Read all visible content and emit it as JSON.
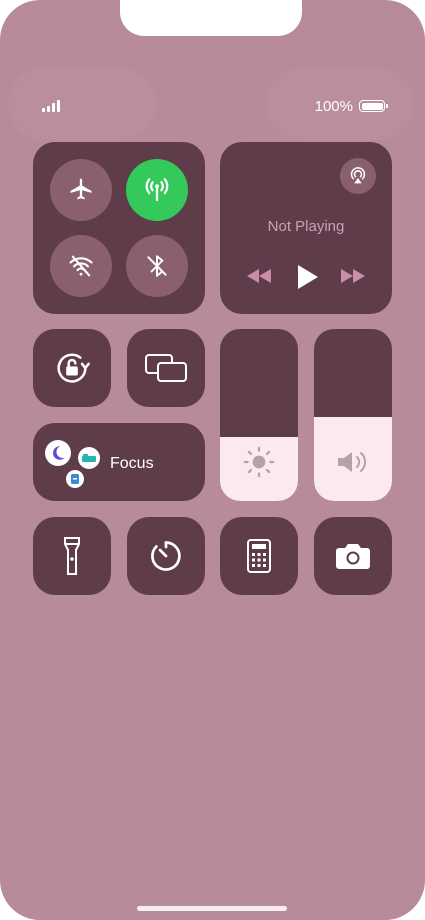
{
  "status_bar": {
    "battery_percent": "100%",
    "signal_bars": 4
  },
  "connectivity": {
    "airplane": {
      "icon": "airplane-icon",
      "active": false
    },
    "cellular": {
      "icon": "cellular-antenna-icon",
      "active": true,
      "active_color": "#33c95b"
    },
    "wifi": {
      "icon": "wifi-off-icon",
      "active": false
    },
    "bluetooth": {
      "icon": "bluetooth-off-icon",
      "active": false
    }
  },
  "media": {
    "now_playing": "Not Playing",
    "airplay_icon": "airplay-audio-icon",
    "controls": [
      "rewind-icon",
      "play-icon",
      "fast-forward-icon"
    ]
  },
  "toggles": {
    "orientation_lock_icon": "orientation-lock-icon",
    "screen_mirroring_icon": "screen-mirroring-icon"
  },
  "focus": {
    "label": "Focus",
    "icons": [
      "moon-icon",
      "bed-icon",
      "id-badge-icon"
    ]
  },
  "sliders": {
    "brightness": {
      "level_percent": 37,
      "icon": "sun-icon"
    },
    "volume": {
      "level_percent": 49,
      "icon": "speaker-icon"
    }
  },
  "bottom_row": [
    "flashlight-icon",
    "timer-icon",
    "calculator-icon",
    "camera-icon"
  ],
  "colors": {
    "background": "#b88b9c",
    "tile": "#5f3c4a",
    "circle": "#8a5f70",
    "slider_fill": "#fce8f0"
  }
}
